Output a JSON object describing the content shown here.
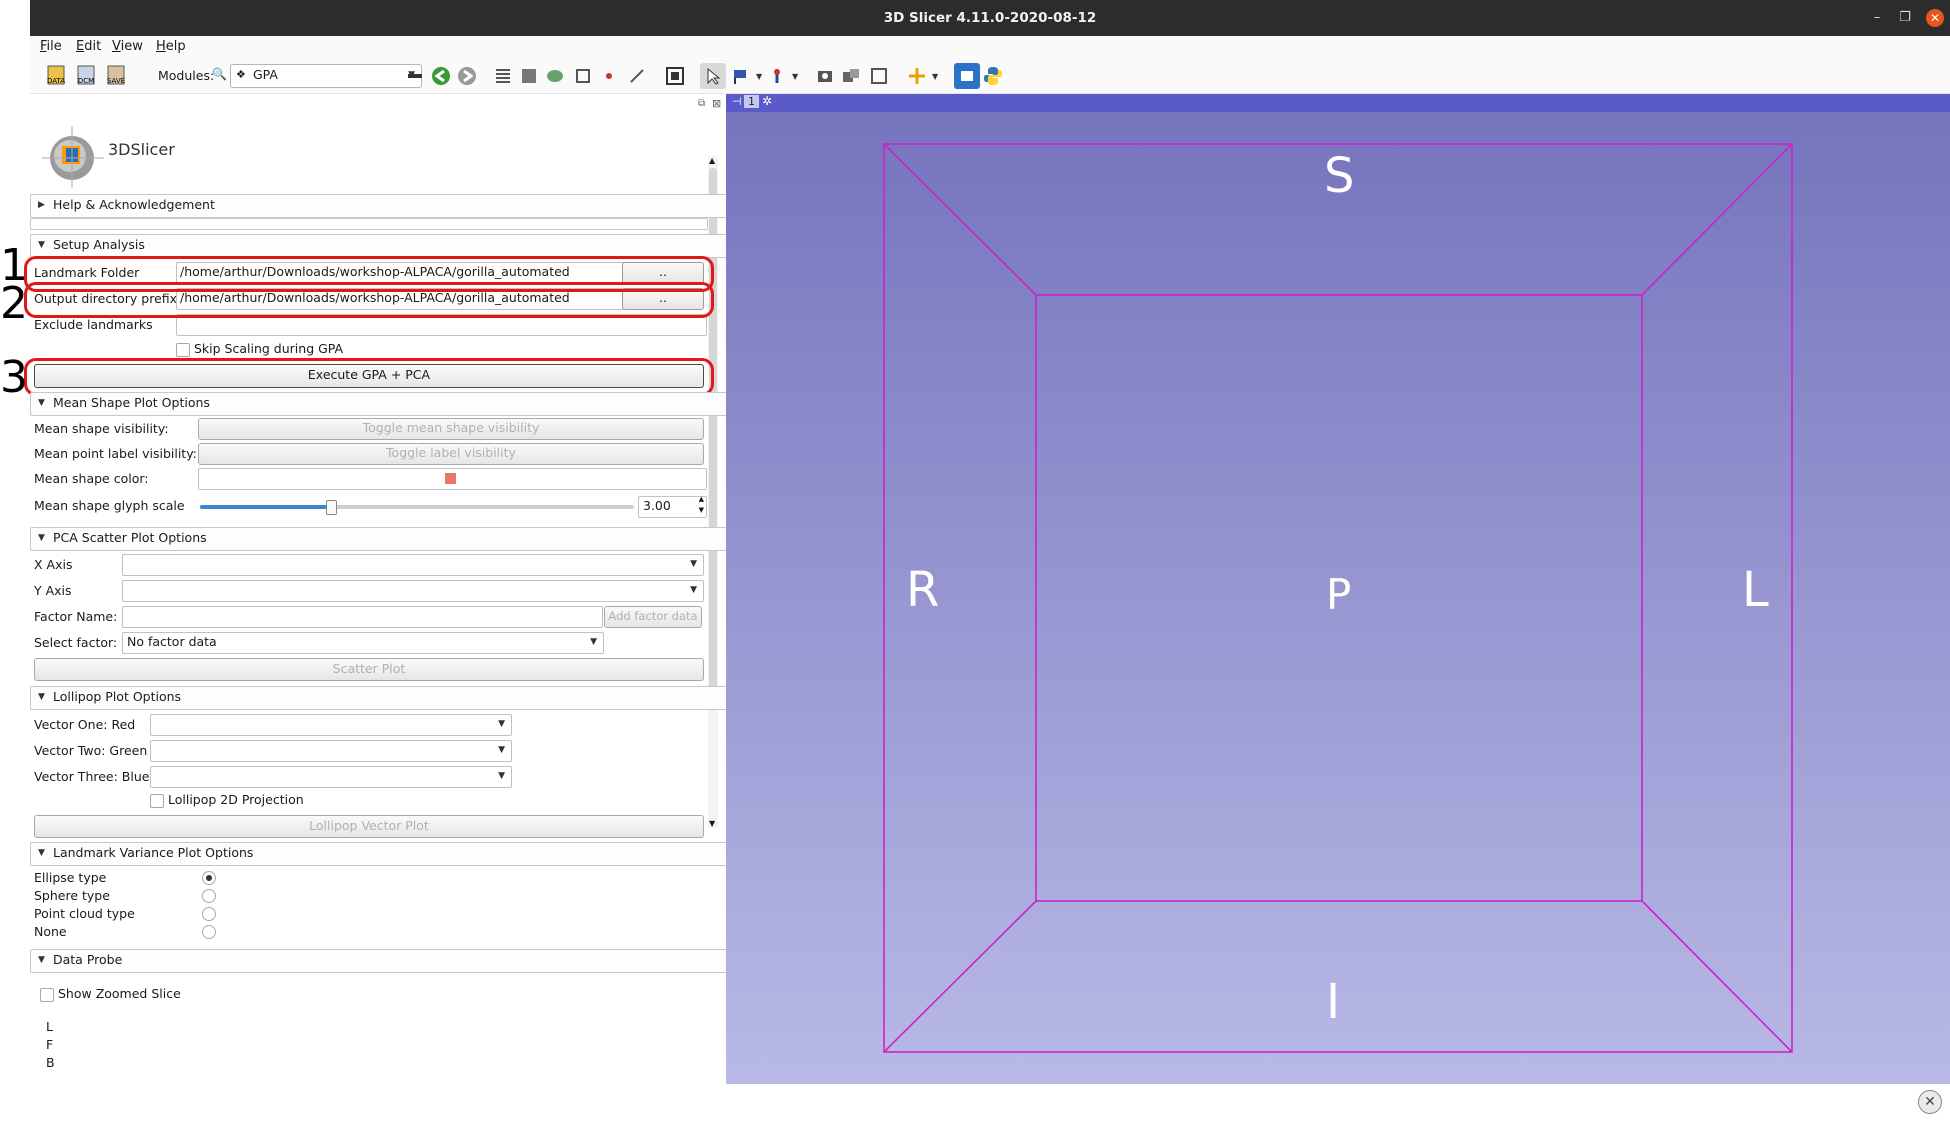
{
  "window": {
    "title": "3D Slicer 4.11.0-2020-08-12",
    "min": "–",
    "restore": "❐",
    "close": "✕"
  },
  "menubar": {
    "items": [
      "File",
      "Edit",
      "View",
      "Help"
    ]
  },
  "toolbar": {
    "data_label": "DATA",
    "dcm_label": "DCM",
    "save_label": "SAVE",
    "modules_label": "Modules:",
    "module_selected": "GPA"
  },
  "left": {
    "logo_text": "3DSlicer",
    "sections": {
      "help": "Help & Acknowledgement",
      "setup": "Setup Analysis",
      "mean_shape": "Mean Shape Plot Options",
      "pca": "PCA Scatter Plot Options",
      "lollipop": "Lollipop Plot Options",
      "variance": "Landmark Variance Plot Options",
      "probe": "Data Probe"
    },
    "setup": {
      "landmark_folder_label": "Landmark Folder",
      "landmark_folder_value": "/home/arthur/Downloads/workshop-ALPACA/gorilla_automated",
      "output_prefix_label": "Output directory prefix",
      "output_prefix_value": "/home/arthur/Downloads/workshop-ALPACA/gorilla_automated",
      "browse": "..",
      "exclude_label": "Exclude landmarks",
      "skip_scaling_label": "Skip Scaling during GPA",
      "execute_label": "Execute GPA + PCA"
    },
    "mean_shape": {
      "visibility_label": "Mean shape visibility:",
      "visibility_btn": "Toggle mean shape visibility",
      "point_label": "Mean point label visibility:",
      "point_btn": "Toggle label visibility",
      "color_label": "Mean shape color:",
      "color_value": "#e8766a",
      "glyph_label": "Mean shape glyph scale",
      "glyph_value": "3.00",
      "glyph_fraction": 0.3
    },
    "pca": {
      "x_label": "X Axis",
      "y_label": "Y Axis",
      "factor_name_label": "Factor Name:",
      "add_factor_btn": "Add factor data",
      "select_factor_label": "Select factor:",
      "select_factor_value": "No factor data",
      "scatter_btn": "Scatter Plot"
    },
    "lollipop": {
      "v1_label": "Vector One: Red",
      "v2_label": "Vector Two: Green",
      "v3_label": "Vector Three: Blue",
      "projection_label": "Lollipop 2D Projection",
      "plot_btn": "Lollipop Vector Plot"
    },
    "variance": {
      "options": [
        "Ellipse type",
        "Sphere type",
        "Point cloud type",
        "None"
      ],
      "selected": "Ellipse type"
    },
    "probe": {
      "zoom_label": "Show Zoomed Slice",
      "lines": [
        "L",
        "F",
        "B"
      ]
    }
  },
  "annotations": {
    "one": "1",
    "two": "2",
    "three": "3"
  },
  "view": {
    "tab_label": "1",
    "orientation": {
      "top": "S",
      "left": "R",
      "center": "P",
      "right": "L",
      "bottom": "I"
    },
    "box_color": "#cc22cc"
  }
}
